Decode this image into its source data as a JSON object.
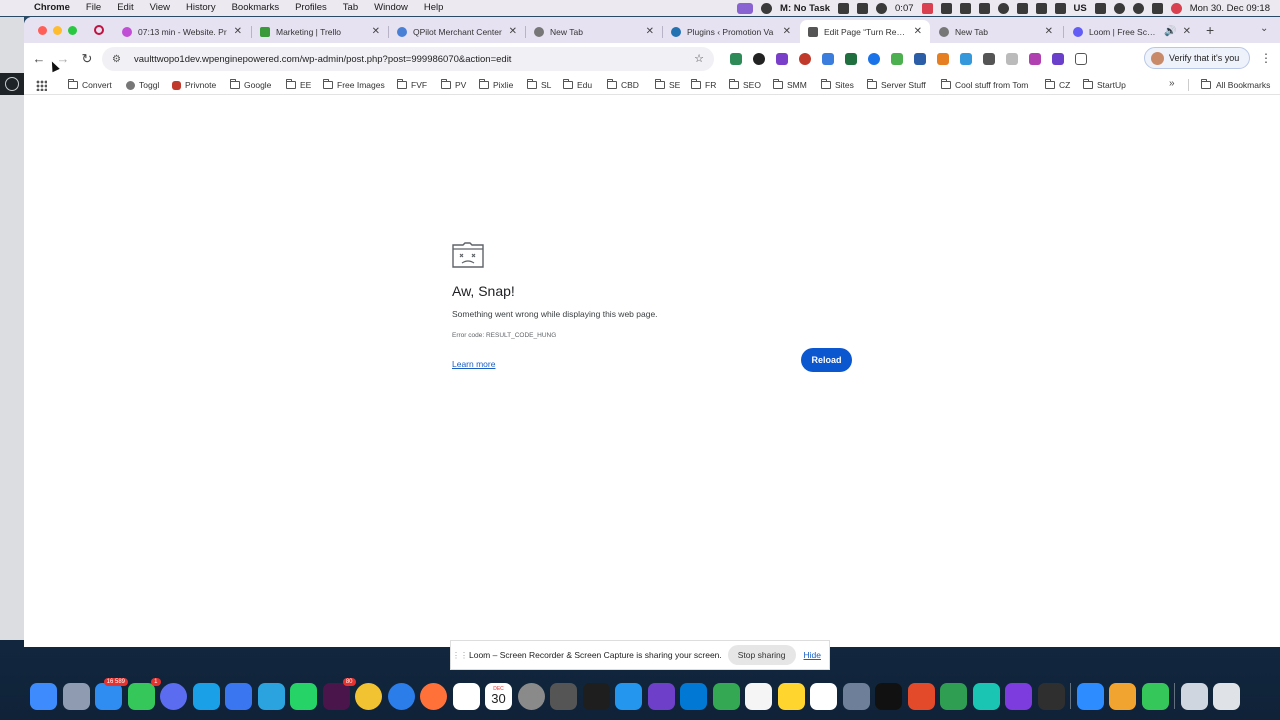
{
  "menubar": {
    "app": "Chrome",
    "items": [
      "File",
      "Edit",
      "View",
      "History",
      "Bookmarks",
      "Profiles",
      "Tab",
      "Window",
      "Help"
    ],
    "task": "M: No Task",
    "timer": "0:07",
    "keyboard": "US",
    "datetime": "Mon 30. Dec  09:18"
  },
  "tabs": [
    {
      "title": "07:13 min - Website. Pr",
      "favicon_color": "#c04fd6"
    },
    {
      "title": "Marketing | Trello",
      "favicon_color": "#3a9a3a"
    },
    {
      "title": "QPilot Merchant Center",
      "favicon_color": "#4a7fd6"
    },
    {
      "title": "New Tab",
      "favicon_color": "#777777"
    },
    {
      "title": "Plugins ‹ Promotion Va",
      "favicon_color": "#2271b1"
    },
    {
      "title": "Edit Page “Turn Reward",
      "favicon_color": "#555555",
      "active": true
    },
    {
      "title": "New Tab",
      "favicon_color": "#777777"
    },
    {
      "title": "Loom | Free Screen",
      "favicon_color": "#625df5"
    }
  ],
  "toolbar": {
    "url": "vaulttwopo1dev.wpenginepowered.com/wp-admin/post.php?post=999986070&action=edit",
    "verify_label": "Verify that it's you"
  },
  "bookmarks": [
    "Convert",
    "Toggl",
    "Privnote",
    "Google",
    "EE",
    "Free Images",
    "FVF",
    "PV",
    "Pixlie",
    "SL",
    "Edu",
    "CBD",
    "SE",
    "FR",
    "SEO",
    "SMM",
    "Sites",
    "Server Stuff",
    "Cool stuff from Tom",
    "CZ",
    "StartUp"
  ],
  "bookmarks_all": "All Bookmarks",
  "error": {
    "title": "Aw, Snap!",
    "message": "Something went wrong while displaying this web page.",
    "code": "Error code: RESULT_CODE_HUNG",
    "learn_more": "Learn more",
    "reload": "Reload"
  },
  "loom_bar": {
    "message": "Loom – Screen Recorder & Screen Capture is sharing your screen.",
    "stop": "Stop sharing",
    "hide": "Hide"
  },
  "dock": {
    "mail_badge": "16 589",
    "messages_badge": "1",
    "slack_badge": "80",
    "calendar_month": "DEC",
    "calendar_day": "30"
  },
  "colors": {
    "accent": "#0b57d0",
    "tabstrip": "#e7e2f2"
  }
}
